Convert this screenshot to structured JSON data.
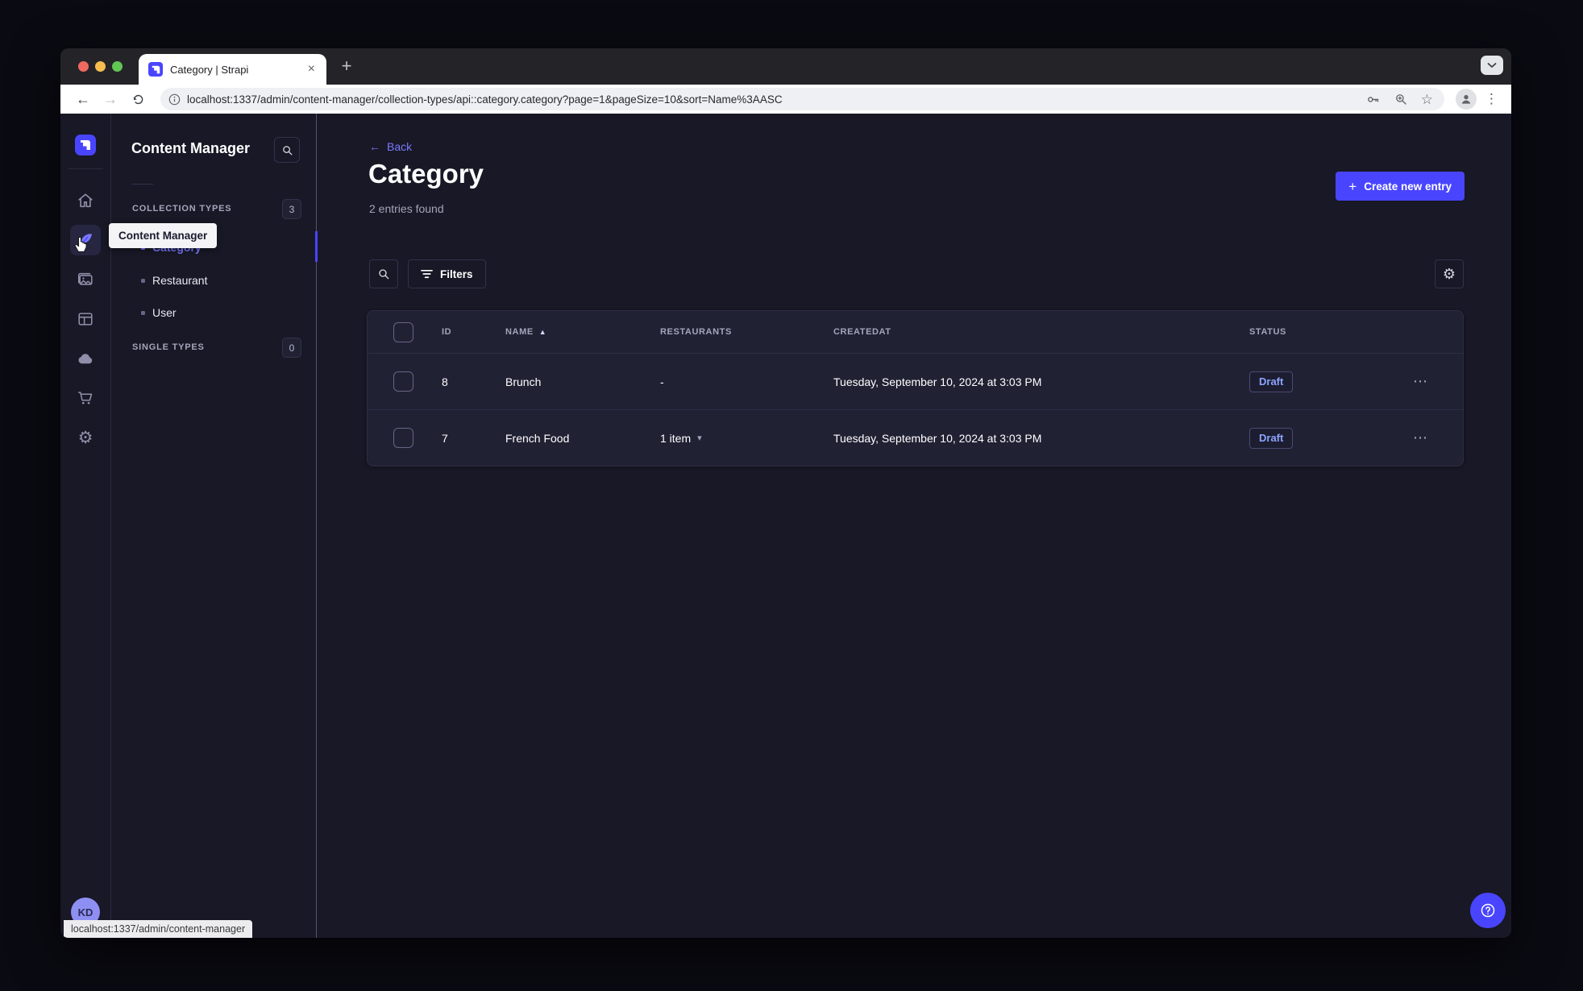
{
  "glyphs": {
    "plus": "+",
    "close": "×",
    "back_arrow": "←",
    "forward_arrow": "→",
    "left_arrow": "←",
    "star": "☆",
    "menu_dots_v": "⋮",
    "row_menu_dots": "⋯",
    "sort_asc": "▲",
    "caret_down": "▾",
    "gear": "⚙"
  },
  "browser": {
    "tab_title": "Category | Strapi",
    "url": "localhost:1337/admin/content-manager/collection-types/api::category.category?page=1&pageSize=10&sort=Name%3AASC",
    "status_bar": "localhost:1337/admin/content-manager"
  },
  "rail": {
    "avatar_initials": "KD"
  },
  "subsidebar": {
    "title": "Content Manager",
    "collection_types_label": "COLLECTION TYPES",
    "collection_types_count": "3",
    "single_types_label": "SINGLE TYPES",
    "single_types_count": "0",
    "items": [
      {
        "label": "Category"
      },
      {
        "label": "Restaurant"
      },
      {
        "label": "User"
      }
    ]
  },
  "tooltip_text": "Content Manager",
  "main": {
    "back_label": "Back",
    "title": "Category",
    "entries_found": "2 entries found",
    "create_button_label": "Create new entry",
    "filters_button_label": "Filters",
    "table": {
      "headers": {
        "id": "ID",
        "name": "NAME",
        "restaurants": "RESTAURANTS",
        "createdat": "CREATEDAT",
        "status": "STATUS"
      },
      "rows": [
        {
          "id": "8",
          "name": "Brunch",
          "restaurants": "-",
          "createdat": "Tuesday, September 10, 2024 at 3:03 PM",
          "status": "Draft"
        },
        {
          "id": "7",
          "name": "French Food",
          "restaurants": "1 item",
          "createdat": "Tuesday, September 10, 2024 at 3:03 PM",
          "status": "Draft"
        }
      ]
    }
  },
  "colors": {
    "primary": "#4945ff",
    "primary_light": "#7b79ff",
    "app_background": "#181826",
    "surface": "#212134",
    "text_secondary": "#a5a5ba",
    "draft_text": "#8ba4ff"
  }
}
